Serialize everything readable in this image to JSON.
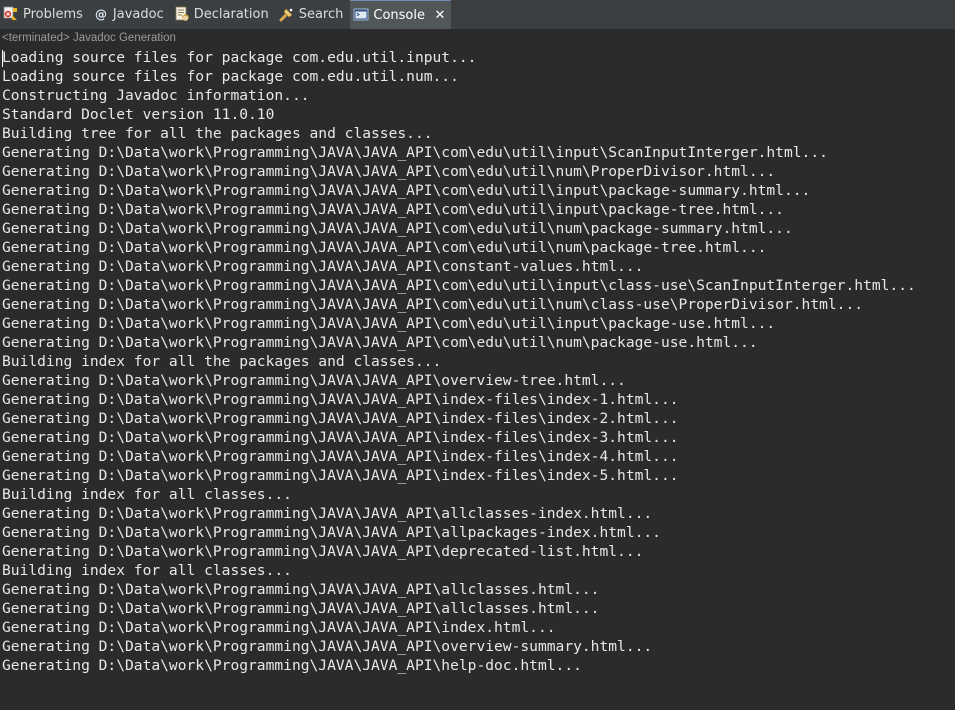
{
  "tabs": [
    {
      "label": "Problems",
      "icon": "problems-icon"
    },
    {
      "label": "Javadoc",
      "icon": "javadoc-icon"
    },
    {
      "label": "Declaration",
      "icon": "declaration-icon"
    },
    {
      "label": "Search",
      "icon": "search-icon"
    },
    {
      "label": "Console",
      "icon": "console-icon",
      "active": true
    }
  ],
  "console": {
    "status": "<terminated> Javadoc Generation",
    "lines": [
      "Loading source files for package com.edu.util.input...",
      "Loading source files for package com.edu.util.num...",
      "Constructing Javadoc information...",
      "Standard Doclet version 11.0.10",
      "Building tree for all the packages and classes...",
      "Generating D:\\Data\\work\\Programming\\JAVA\\JAVA_API\\com\\edu\\util\\input\\ScanInputInterger.html...",
      "Generating D:\\Data\\work\\Programming\\JAVA\\JAVA_API\\com\\edu\\util\\num\\ProperDivisor.html...",
      "Generating D:\\Data\\work\\Programming\\JAVA\\JAVA_API\\com\\edu\\util\\input\\package-summary.html...",
      "Generating D:\\Data\\work\\Programming\\JAVA\\JAVA_API\\com\\edu\\util\\input\\package-tree.html...",
      "Generating D:\\Data\\work\\Programming\\JAVA\\JAVA_API\\com\\edu\\util\\num\\package-summary.html...",
      "Generating D:\\Data\\work\\Programming\\JAVA\\JAVA_API\\com\\edu\\util\\num\\package-tree.html...",
      "Generating D:\\Data\\work\\Programming\\JAVA\\JAVA_API\\constant-values.html...",
      "Generating D:\\Data\\work\\Programming\\JAVA\\JAVA_API\\com\\edu\\util\\input\\class-use\\ScanInputInterger.html...",
      "Generating D:\\Data\\work\\Programming\\JAVA\\JAVA_API\\com\\edu\\util\\num\\class-use\\ProperDivisor.html...",
      "Generating D:\\Data\\work\\Programming\\JAVA\\JAVA_API\\com\\edu\\util\\input\\package-use.html...",
      "Generating D:\\Data\\work\\Programming\\JAVA\\JAVA_API\\com\\edu\\util\\num\\package-use.html...",
      "Building index for all the packages and classes...",
      "Generating D:\\Data\\work\\Programming\\JAVA\\JAVA_API\\overview-tree.html...",
      "Generating D:\\Data\\work\\Programming\\JAVA\\JAVA_API\\index-files\\index-1.html...",
      "Generating D:\\Data\\work\\Programming\\JAVA\\JAVA_API\\index-files\\index-2.html...",
      "Generating D:\\Data\\work\\Programming\\JAVA\\JAVA_API\\index-files\\index-3.html...",
      "Generating D:\\Data\\work\\Programming\\JAVA\\JAVA_API\\index-files\\index-4.html...",
      "Generating D:\\Data\\work\\Programming\\JAVA\\JAVA_API\\index-files\\index-5.html...",
      "Building index for all classes...",
      "Generating D:\\Data\\work\\Programming\\JAVA\\JAVA_API\\allclasses-index.html...",
      "Generating D:\\Data\\work\\Programming\\JAVA\\JAVA_API\\allpackages-index.html...",
      "Generating D:\\Data\\work\\Programming\\JAVA\\JAVA_API\\deprecated-list.html...",
      "Building index for all classes...",
      "Generating D:\\Data\\work\\Programming\\JAVA\\JAVA_API\\allclasses.html...",
      "Generating D:\\Data\\work\\Programming\\JAVA\\JAVA_API\\allclasses.html...",
      "Generating D:\\Data\\work\\Programming\\JAVA\\JAVA_API\\index.html...",
      "Generating D:\\Data\\work\\Programming\\JAVA\\JAVA_API\\overview-summary.html...",
      "Generating D:\\Data\\work\\Programming\\JAVA\\JAVA_API\\help-doc.html..."
    ]
  },
  "colors": {
    "background": "#2b2b2b",
    "tabbar": "#3c3f41",
    "active_tab": "#515658",
    "text": "#e8e8e8",
    "status_text": "#9a9a9a"
  }
}
